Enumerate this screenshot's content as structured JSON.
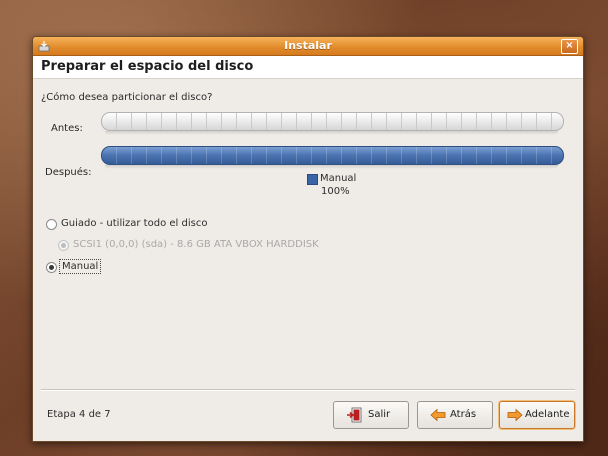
{
  "window": {
    "title": "Instalar",
    "close_label": "×"
  },
  "header": {
    "page_title": "Preparar el espacio del disco"
  },
  "main": {
    "question": "¿Cómo desea particionar el disco?",
    "before_label": "Antes:",
    "after_label": "Después:",
    "legend": {
      "name": "Manual",
      "percent": "100%",
      "color": "#3a64a5"
    },
    "options": {
      "guided": "Guiado - utilizar todo el disco",
      "disk": "SCSI1 (0,0,0) (sda) - 8.6 GB ATA VBOX HARDDISK",
      "manual": "Manual",
      "selected": "manual"
    }
  },
  "footer": {
    "step": "Etapa 4 de 7",
    "quit_label": "Salir",
    "back_label": "Atrás",
    "forward_label": "Adelante"
  },
  "icons": {
    "app": "installer-icon",
    "quit": "exit-icon",
    "back": "arrow-left-icon",
    "forward": "arrow-right-icon"
  },
  "colors": {
    "titlebar": "#e08a2a",
    "partition": "#3a64a5"
  }
}
